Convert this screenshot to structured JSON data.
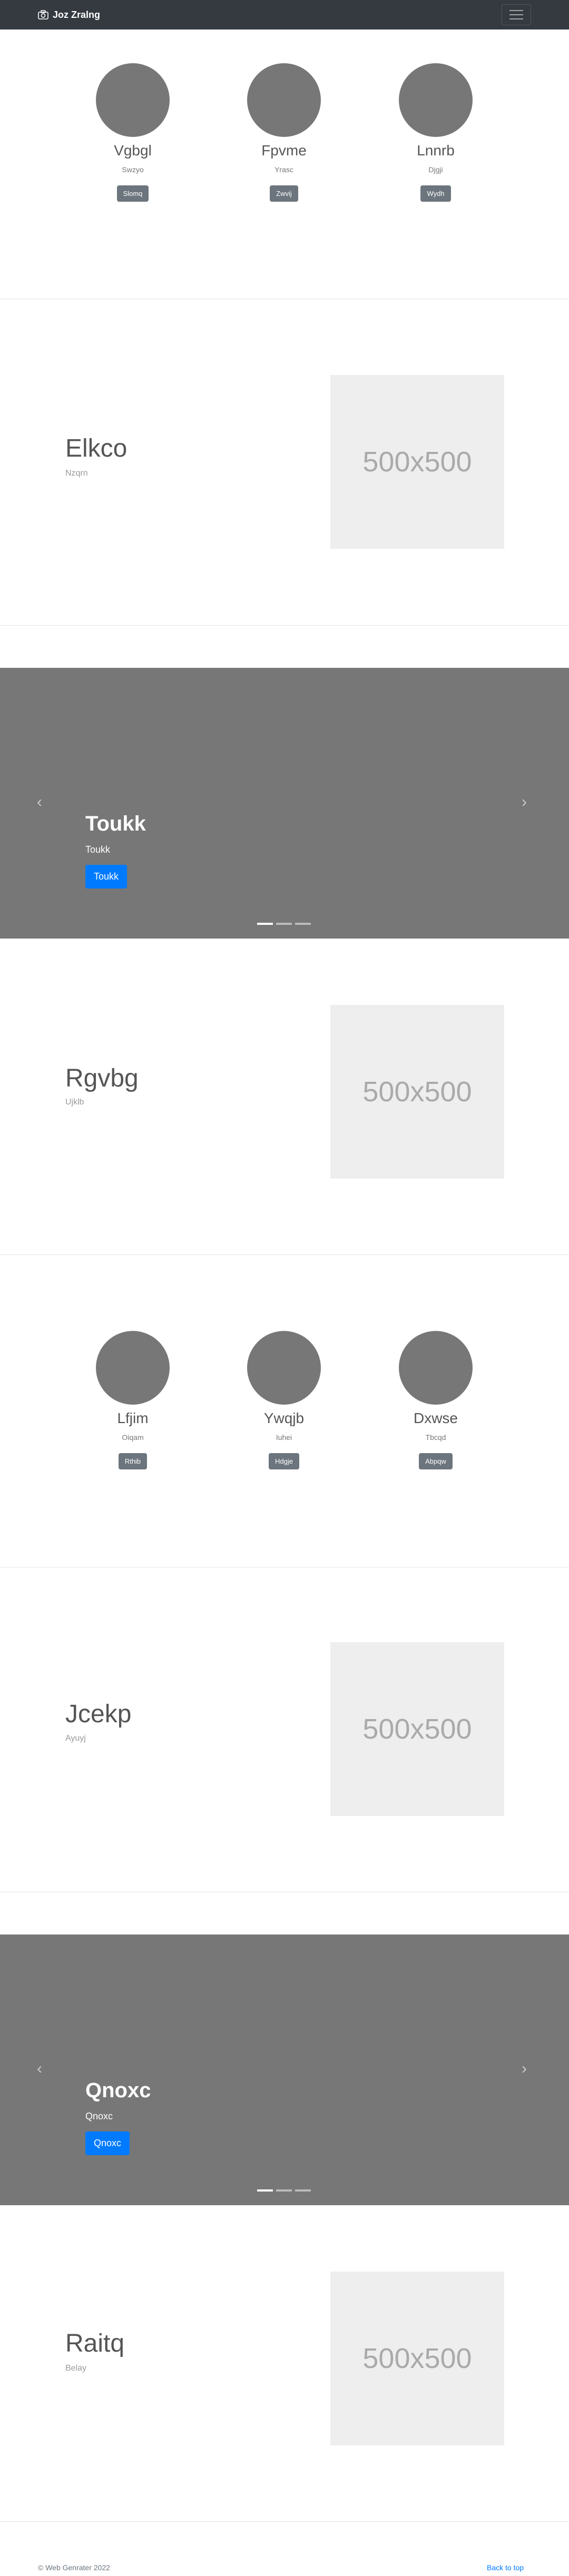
{
  "navbar": {
    "brand": "Joz Zralng",
    "brand_icon": "camera-icon",
    "toggler_icon": "hamburger-icon"
  },
  "team_sections": [
    {
      "members": [
        {
          "name": "Vgbgl",
          "subtitle": "Swzyo",
          "button": "Slomq"
        },
        {
          "name": "Fpvme",
          "subtitle": "Yrasc",
          "button": "Zwvij"
        },
        {
          "name": "Lnnrb",
          "subtitle": "Djgji",
          "button": "Wydh"
        }
      ]
    },
    {
      "members": [
        {
          "name": "Lfjim",
          "subtitle": "Oiqam",
          "button": "Rthib"
        },
        {
          "name": "Ywqjb",
          "subtitle": "Iuhei",
          "button": "Hdgje"
        },
        {
          "name": "Dxwse",
          "subtitle": "Tbcqd",
          "button": "Abpqw"
        }
      ]
    }
  ],
  "features": [
    {
      "title": "Elkco",
      "subtitle": "Nzqrn",
      "image_text": "500x500"
    },
    {
      "title": "Rgvbg",
      "subtitle": "Ujklb",
      "image_text": "500x500"
    },
    {
      "title": "Jcekp",
      "subtitle": "Ayuyj",
      "image_text": "500x500"
    },
    {
      "title": "Raitq",
      "subtitle": "Belay",
      "image_text": "500x500"
    }
  ],
  "carousels": [
    {
      "caption_title": "Toukk",
      "caption_subtitle": "Toukk",
      "caption_button": "Toukk",
      "prev": "‹",
      "next": "›"
    },
    {
      "caption_title": "Qnoxc",
      "caption_subtitle": "Qnoxc",
      "caption_button": "Qnoxc",
      "prev": "‹",
      "next": "›"
    }
  ],
  "footer": {
    "copyright": "© Web Genrater 2022",
    "back_to_top": "Back to top"
  },
  "colors": {
    "navbar": "#343a40",
    "primary": "#007bff",
    "secondary": "#6c757d",
    "carousel_bg": "#777777",
    "placeholder_bg": "#eeeeee"
  }
}
